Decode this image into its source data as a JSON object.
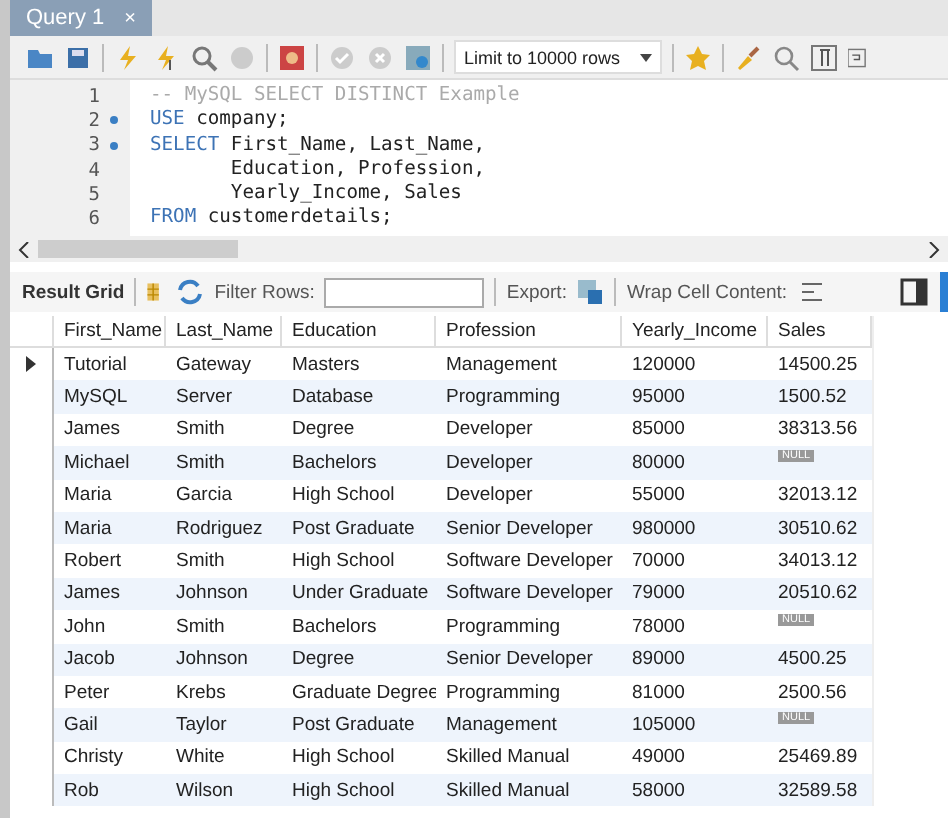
{
  "tabs": [
    {
      "label": "Query 1",
      "close": "×",
      "selected": true
    }
  ],
  "toolbar": {
    "limit": "Limit to 10000 rows"
  },
  "editor": {
    "lines": [
      {
        "number": "1",
        "marker": false,
        "segments": [
          {
            "kind": "comment",
            "text": "-- MySQL SELECT DISTINCT Example"
          }
        ]
      },
      {
        "number": "2",
        "marker": true,
        "segments": [
          {
            "kind": "keyword",
            "text": "USE"
          },
          {
            "kind": "text",
            "text": " company;"
          }
        ]
      },
      {
        "number": "3",
        "marker": true,
        "segments": [
          {
            "kind": "keyword",
            "text": "SELECT"
          },
          {
            "kind": "text",
            "text": " First_Name, Last_Name,"
          }
        ]
      },
      {
        "number": "4",
        "marker": false,
        "segments": [
          {
            "kind": "text",
            "text": "       Education, Profession,"
          }
        ]
      },
      {
        "number": "5",
        "marker": false,
        "segments": [
          {
            "kind": "text",
            "text": "       Yearly_Income, Sales"
          }
        ]
      },
      {
        "number": "6",
        "marker": false,
        "segments": [
          {
            "kind": "keyword",
            "text": "FROM"
          },
          {
            "kind": "text",
            "text": " customerdetails;"
          }
        ]
      }
    ]
  },
  "result_toolbar": {
    "title": "Result Grid",
    "filter_label": "Filter Rows:",
    "export_label": "Export:",
    "wrap_label": "Wrap Cell Content:"
  },
  "table": {
    "columns": [
      "First_Name",
      "Last_Name",
      "Education",
      "Profession",
      "Yearly_Income",
      "Sales"
    ],
    "rows": [
      {
        "selected": true,
        "cells": [
          "Tutorial",
          "Gateway",
          "Masters",
          "Management",
          "120000",
          "14500.25"
        ],
        "sales_null": false
      },
      {
        "selected": false,
        "cells": [
          "MySQL",
          "Server",
          "Database",
          "Programming",
          "95000",
          "1500.52"
        ],
        "sales_null": false
      },
      {
        "selected": false,
        "cells": [
          "James",
          "Smith",
          "Degree",
          "Developer",
          "85000",
          "38313.56"
        ],
        "sales_null": false
      },
      {
        "selected": false,
        "cells": [
          "Michael",
          "Smith",
          "Bachelors",
          "Developer",
          "80000",
          "NULL"
        ],
        "sales_null": true
      },
      {
        "selected": false,
        "cells": [
          "Maria",
          "Garcia",
          "High School",
          "Developer",
          "55000",
          "32013.12"
        ],
        "sales_null": false
      },
      {
        "selected": false,
        "cells": [
          "Maria",
          "Rodriguez",
          "Post Graduate",
          "Senior Developer",
          "980000",
          "30510.62"
        ],
        "sales_null": false
      },
      {
        "selected": false,
        "cells": [
          "Robert",
          "Smith",
          "High School",
          "Software Developer",
          "70000",
          "34013.12"
        ],
        "sales_null": false
      },
      {
        "selected": false,
        "cells": [
          "James",
          "Johnson",
          "Under Graduate",
          "Software Developer",
          "79000",
          "20510.62"
        ],
        "sales_null": false
      },
      {
        "selected": false,
        "cells": [
          "John",
          "Smith",
          "Bachelors",
          "Programming",
          "78000",
          "NULL"
        ],
        "sales_null": true
      },
      {
        "selected": false,
        "cells": [
          "Jacob",
          "Johnson",
          "Degree",
          "Senior Developer",
          "89000",
          "4500.25"
        ],
        "sales_null": false
      },
      {
        "selected": false,
        "cells": [
          "Peter",
          "Krebs",
          "Graduate Degree",
          "Programming",
          "81000",
          "2500.56"
        ],
        "sales_null": false
      },
      {
        "selected": false,
        "cells": [
          "Gail",
          "Taylor",
          "Post Graduate",
          "Management",
          "105000",
          "NULL"
        ],
        "sales_null": true
      },
      {
        "selected": false,
        "cells": [
          "Christy",
          "White",
          "High School",
          "Skilled Manual",
          "49000",
          "25469.89"
        ],
        "sales_null": false
      },
      {
        "selected": false,
        "cells": [
          "Rob",
          "Wilson",
          "High School",
          "Skilled Manual",
          "58000",
          "32589.58"
        ],
        "sales_null": false
      }
    ]
  }
}
